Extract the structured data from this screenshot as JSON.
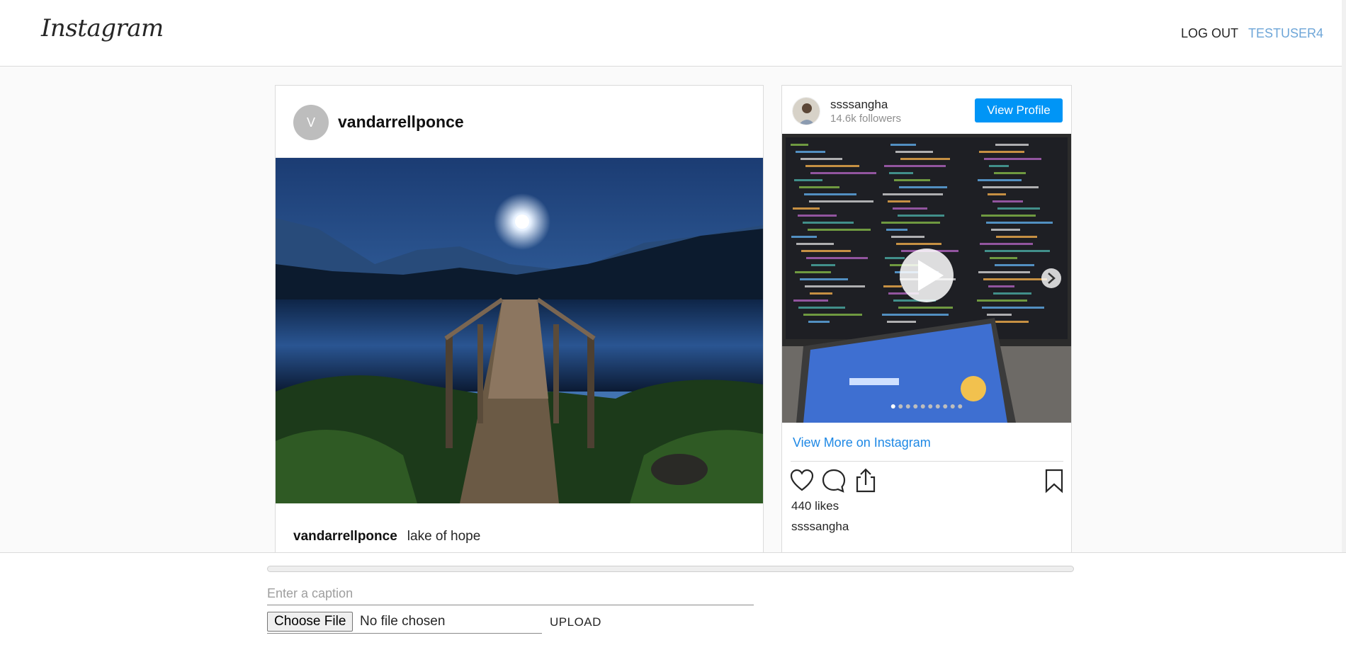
{
  "header": {
    "logo": "Instagram",
    "logout": "LOG OUT",
    "username": "TESTUSER4"
  },
  "post": {
    "avatar_letter": "V",
    "username": "vandarrellponce",
    "caption_user": "vandarrellponce",
    "caption_text": "lake of hope"
  },
  "embed": {
    "username": "ssssangha",
    "followers": "14.6k followers",
    "view_profile": "View Profile",
    "view_more": "View More on Instagram",
    "likes": "440 likes",
    "owner": "ssssangha",
    "carousel_dots": 10,
    "carousel_active": 0
  },
  "upload": {
    "progress": 0,
    "caption_placeholder": "Enter a caption",
    "choose_file": "Choose File",
    "no_file": "No file chosen",
    "upload_label": "UPLOAD"
  },
  "colors": {
    "accent": "#0095f6",
    "link": "#1e88e5",
    "user_link": "#6ea6d8"
  }
}
